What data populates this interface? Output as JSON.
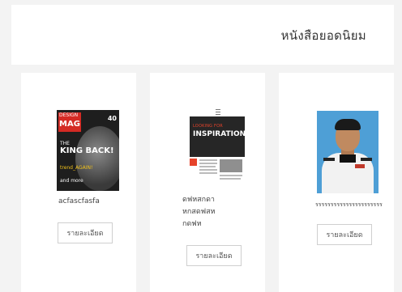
{
  "section": {
    "title": "หนังสือยอดนิยม"
  },
  "books": [
    {
      "title_lines": [
        "acfascfasfa"
      ],
      "button_label": "รายละเอียด",
      "cover": "magazine-cover",
      "cover_text": {
        "top": "DESIGN",
        "masthead": "MAG",
        "badge": "40",
        "line1": "THE",
        "line2": "KING BACK!",
        "line3": "trend_AGAIN!",
        "line4": "and more"
      }
    },
    {
      "title_lines": [
        "ดฟหสกดา",
        "หกสดฟสห",
        "กดฟห"
      ],
      "button_label": "รายละเอียด",
      "cover": "inspiration-brochure-cover",
      "cover_text": {
        "tagline": "LOOKING FOR",
        "headline": "INSPIRATION?"
      }
    },
    {
      "title_lines": [
        "รรรรรรรรรรรรรรรรรรรรรร"
      ],
      "button_label": "รายละเอียด",
      "cover": "portrait-photo"
    }
  ]
}
